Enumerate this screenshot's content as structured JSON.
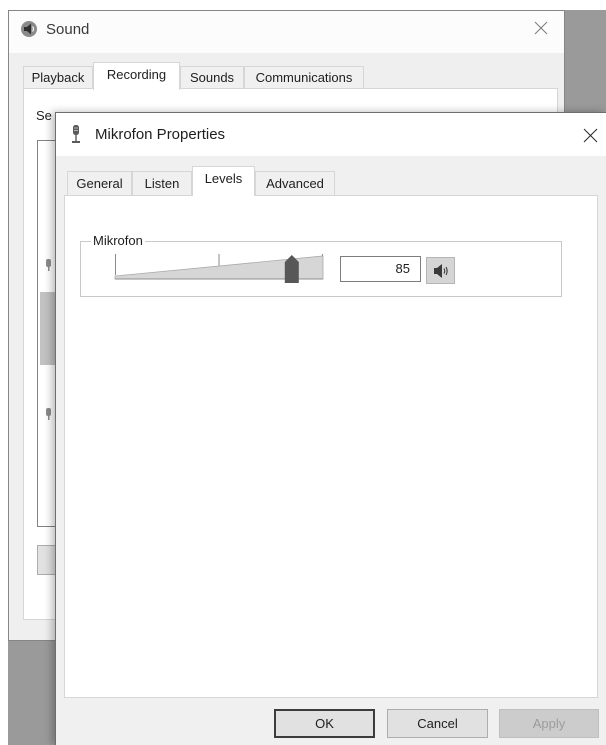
{
  "sound_window": {
    "title": "Sound",
    "title_icon": "speaker-icon",
    "close_icon": "close-icon",
    "tabs": [
      {
        "label": "Playback",
        "selected": false
      },
      {
        "label": "Recording",
        "selected": true
      },
      {
        "label": "Sounds",
        "selected": false
      },
      {
        "label": "Communications",
        "selected": false
      }
    ],
    "instruction": "Se"
  },
  "properties_dialog": {
    "title": "Mikrofon Properties",
    "title_icon": "microphone-icon",
    "close_icon": "close-icon",
    "tabs": [
      {
        "label": "General",
        "selected": false
      },
      {
        "label": "Listen",
        "selected": false
      },
      {
        "label": "Levels",
        "selected": true
      },
      {
        "label": "Advanced",
        "selected": false
      }
    ],
    "levels": {
      "group_label": "Mikrofon",
      "volume_percent": 85,
      "mute_button_icon": "speaker-icon"
    },
    "buttons": {
      "ok": "OK",
      "cancel": "Cancel",
      "apply": "Apply",
      "apply_enabled": false
    }
  }
}
